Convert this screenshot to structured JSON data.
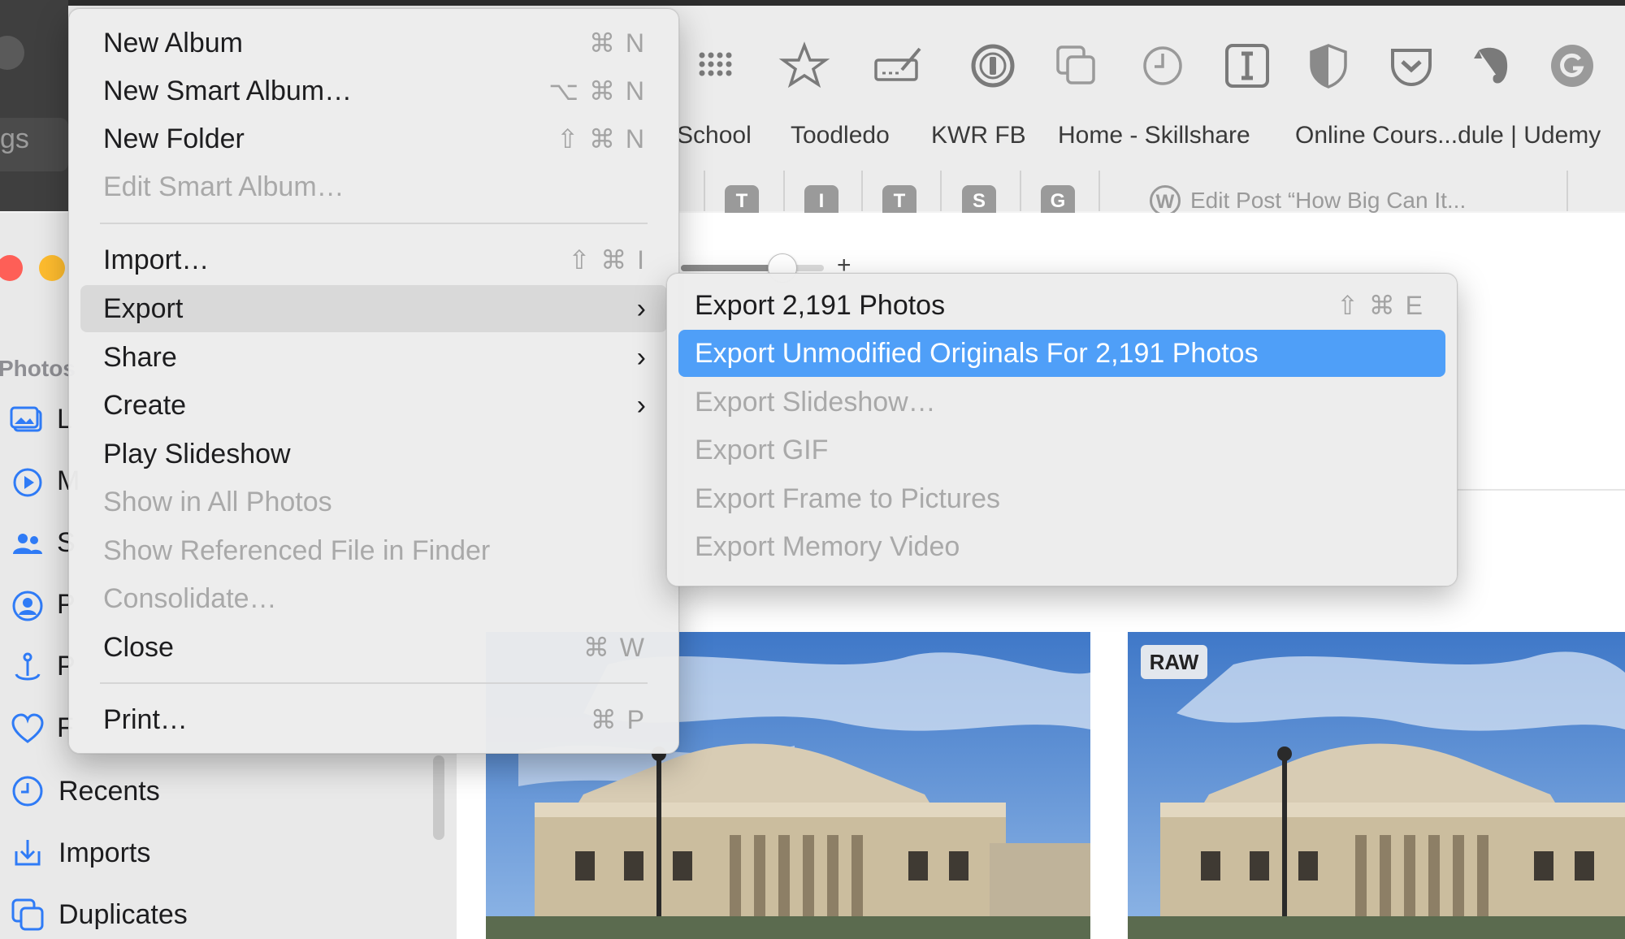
{
  "safari": {
    "bookmarks": [
      "School",
      "Toodledo",
      "KWR FB",
      "Home - Skillshare",
      "Online Cours...dule | Udemy"
    ],
    "tab_letters": [
      "T",
      "I",
      "T",
      "S",
      "G"
    ],
    "tab_title": "Edit Post “How Big Can It...",
    "left_field_text": "gs",
    "toolbar_icons": [
      "apps-grid-icon",
      "star-icon",
      "signature-icon",
      "onepassword-icon",
      "copy-icon",
      "clock-icon",
      "instapaper-icon",
      "shield-icon",
      "pocket-icon",
      "evernote-icon",
      "grammarly-icon"
    ]
  },
  "photos": {
    "sidebar_header": "Photos",
    "sidebar_clipped": [
      "L",
      "M",
      "S",
      "P",
      "P",
      "F"
    ],
    "sidebar_items": [
      {
        "label": "Recents",
        "icon": "clock-icon"
      },
      {
        "label": "Imports",
        "icon": "import-icon"
      },
      {
        "label": "Duplicates",
        "icon": "duplicates-icon"
      }
    ],
    "zoom_plus": "+",
    "raw_badge": "RAW"
  },
  "file_menu": {
    "items": [
      {
        "label": "New Album",
        "shortcut": "⌘ N",
        "enabled": true
      },
      {
        "label": "New Smart Album…",
        "shortcut": "⌥ ⌘ N",
        "enabled": true
      },
      {
        "label": "New Folder",
        "shortcut": "⇧ ⌘ N",
        "enabled": true
      },
      {
        "label": "Edit Smart Album…",
        "shortcut": "",
        "enabled": false
      },
      {
        "label": "Import…",
        "shortcut": "⇧ ⌘ I",
        "enabled": true
      },
      {
        "label": "Export",
        "shortcut": "",
        "enabled": true,
        "submenu": true
      },
      {
        "label": "Share",
        "shortcut": "",
        "enabled": true,
        "submenu": true
      },
      {
        "label": "Create",
        "shortcut": "",
        "enabled": true,
        "submenu": true
      },
      {
        "label": "Play Slideshow",
        "shortcut": "",
        "enabled": true
      },
      {
        "label": "Show in All Photos",
        "shortcut": "",
        "enabled": false
      },
      {
        "label": "Show Referenced File in Finder",
        "shortcut": "",
        "enabled": false
      },
      {
        "label": "Consolidate…",
        "shortcut": "",
        "enabled": false
      },
      {
        "label": "Close",
        "shortcut": "⌘ W",
        "enabled": true
      },
      {
        "label": "Print…",
        "shortcut": "⌘ P",
        "enabled": true
      }
    ],
    "submenu_chevron": "›"
  },
  "export_submenu": {
    "items": [
      {
        "label": "Export 2,191 Photos",
        "shortcut": "⇧ ⌘ E",
        "enabled": true
      },
      {
        "label": "Export Unmodified Originals For 2,191 Photos",
        "shortcut": "",
        "enabled": true,
        "selected": true
      },
      {
        "label": "Export Slideshow…",
        "shortcut": "",
        "enabled": false
      },
      {
        "label": "Export GIF",
        "shortcut": "",
        "enabled": false
      },
      {
        "label": "Export Frame to Pictures",
        "shortcut": "",
        "enabled": false
      },
      {
        "label": "Export Memory Video",
        "shortcut": "",
        "enabled": false
      }
    ]
  },
  "colors": {
    "selection": "#4f9ff8",
    "close": "#fe5f57",
    "minimize": "#febc2e",
    "sidebar_icon": "#2f7bf6"
  }
}
